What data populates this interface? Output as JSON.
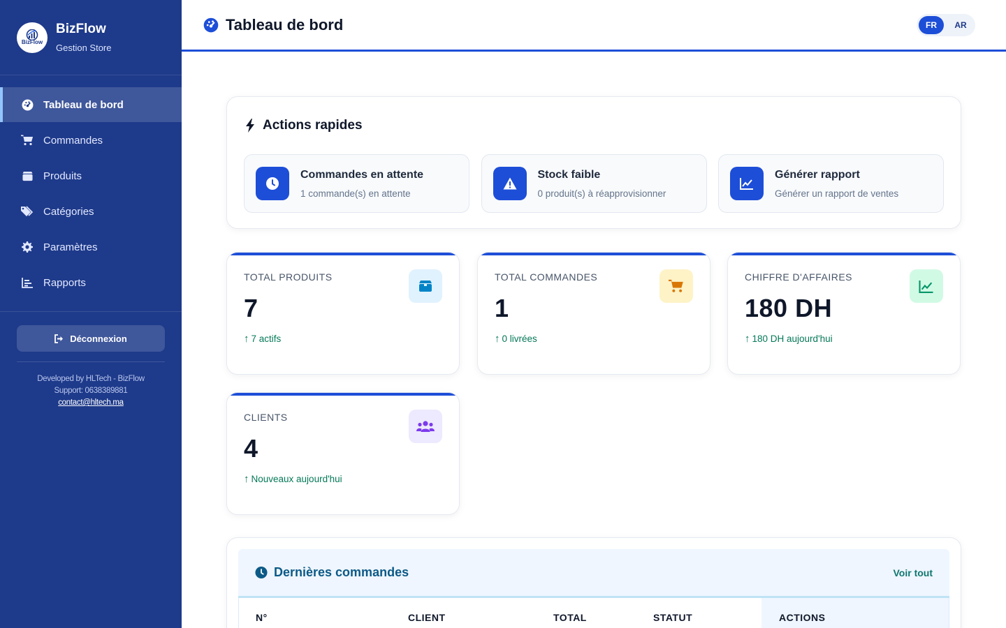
{
  "sidebar": {
    "brand_name": "BizFlow",
    "brand_sub": "Gestion Store",
    "logo_text": "BizFlow",
    "items": [
      {
        "label": "Tableau de bord",
        "icon": "dashboard-icon",
        "active": true
      },
      {
        "label": "Commandes",
        "icon": "cart-icon"
      },
      {
        "label": "Produits",
        "icon": "box-icon"
      },
      {
        "label": "Catégories",
        "icon": "tags-icon"
      },
      {
        "label": "Paramètres",
        "icon": "gear-icon"
      },
      {
        "label": "Rapports",
        "icon": "chart-icon"
      }
    ],
    "logout_label": "Déconnexion",
    "credits_line1": "Developed by HLTech - BizFlow",
    "credits_line2": "Support: 0638389881",
    "credits_email": "contact@hltech.ma"
  },
  "header": {
    "title": "Tableau de bord",
    "lang_fr": "FR",
    "lang_ar": "AR",
    "active_lang": "FR"
  },
  "quick_actions": {
    "title": "Actions rapides",
    "items": [
      {
        "title": "Commandes en attente",
        "sub": "1 commande(s) en attente",
        "icon": "clock-icon"
      },
      {
        "title": "Stock faible",
        "sub": "0 produit(s) à réapprovisionner",
        "icon": "warning-icon"
      },
      {
        "title": "Générer rapport",
        "sub": "Générer un rapport de ventes",
        "icon": "line-chart-icon"
      }
    ]
  },
  "stats": [
    {
      "label": "TOTAL PRODUITS",
      "value": "7",
      "trend": "7 actifs",
      "icon": "box-icon",
      "icon_bg": "#e0f2fe",
      "icon_color": "#0284c7"
    },
    {
      "label": "TOTAL COMMANDES",
      "value": "1",
      "trend": "0 livrées",
      "icon": "cart-icon",
      "icon_bg": "#fef3c7",
      "icon_color": "#d97706"
    },
    {
      "label": "CHIFFRE D'AFFAIRES",
      "value": "180 DH",
      "trend": "180 DH aujourd'hui",
      "icon": "line-chart-icon",
      "icon_bg": "#d1fae5",
      "icon_color": "#059669"
    },
    {
      "label": "CLIENTS",
      "value": "4",
      "trend": "Nouveaux aujourd'hui",
      "icon": "users-icon",
      "icon_bg": "#ede9fe",
      "icon_color": "#7c3aed"
    }
  ],
  "recent_orders": {
    "title": "Dernières commandes",
    "see_all": "Voir tout",
    "columns": [
      "N°",
      "CLIENT",
      "TOTAL",
      "STATUT",
      "ACTIONS"
    ]
  },
  "colors": {
    "sidebar_bg": "#1e3a8a",
    "accent": "#1d4ed8",
    "trend_green": "#047857"
  }
}
